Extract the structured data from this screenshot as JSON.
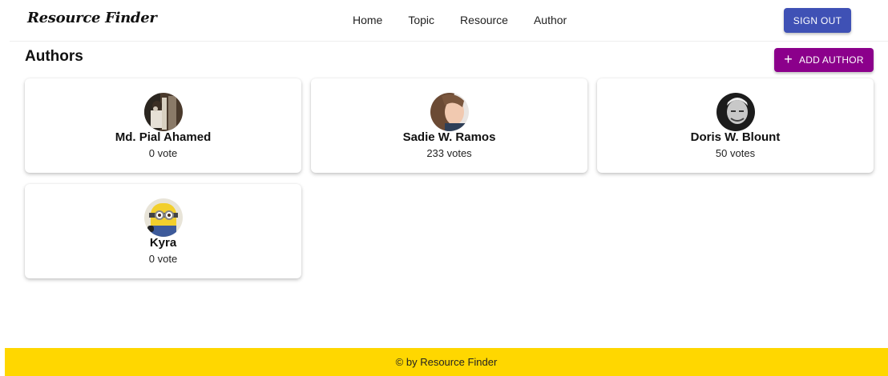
{
  "header": {
    "brand": "Resource Finder",
    "nav": [
      "Home",
      "Topic",
      "Resource",
      "Author"
    ],
    "signout_label": "SIGN OUT"
  },
  "main": {
    "title": "Authors",
    "add_author_label": "ADD AUTHOR",
    "add_icon": "plus-icon",
    "authors": [
      {
        "name": "Md. Pial Ahamed",
        "votes": "0 vote",
        "avatar": "avatar-photo"
      },
      {
        "name": "Sadie W. Ramos",
        "votes": "233 votes",
        "avatar": "avatar-photo"
      },
      {
        "name": "Doris W. Blount",
        "votes": "50 votes",
        "avatar": "avatar-photo"
      },
      {
        "name": "Kyra",
        "votes": "0 vote",
        "avatar": "avatar-photo"
      }
    ]
  },
  "footer": {
    "text": "© by Resource Finder"
  },
  "colors": {
    "signout_bg": "#3f51b5",
    "add_author_bg": "#8b008b",
    "footer_bg": "#ffd700"
  }
}
